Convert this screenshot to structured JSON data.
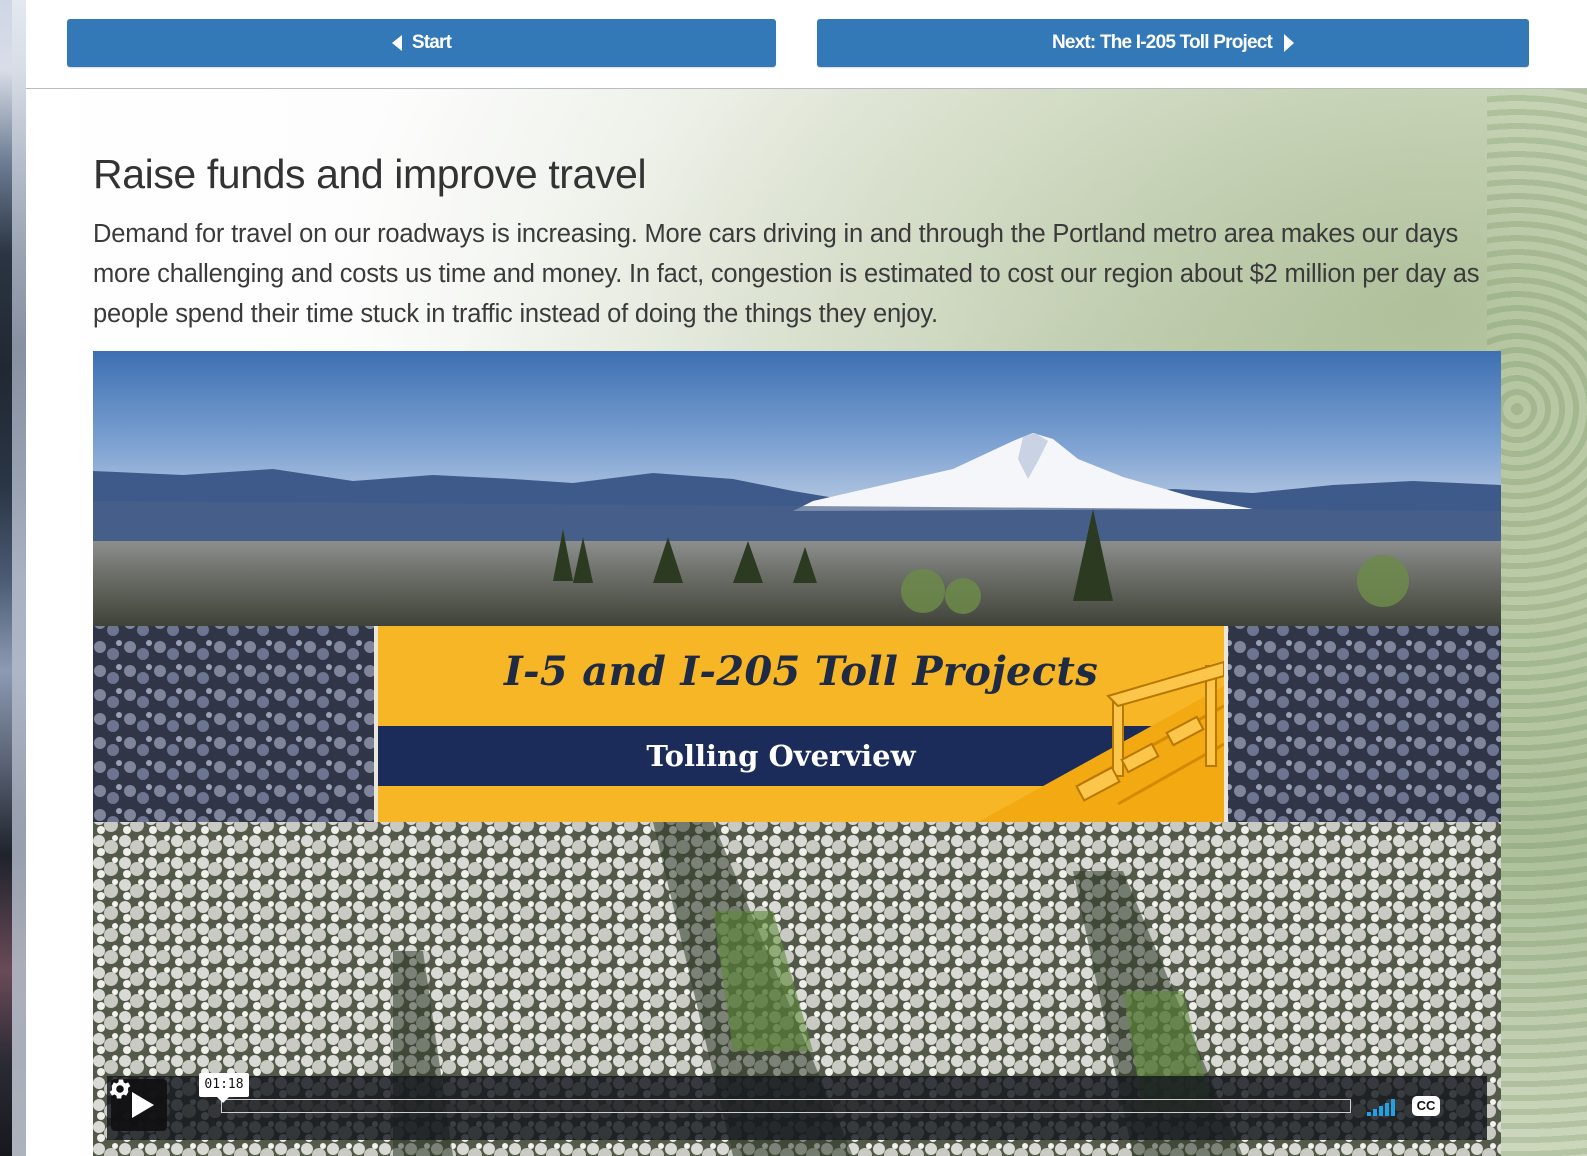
{
  "nav": {
    "start_label": "Start",
    "next_label": "Next: The I-205 Toll Project",
    "accent_color": "#3379b8"
  },
  "section": {
    "title": "Raise funds and improve travel",
    "body": "Demand for travel on our roadways is increasing. More cars driving in and through the Portland metro area makes our days more challenging and costs us time and money. In fact, congestion is estimated to cost our region about $2 million per day as people spend their time stuck in traffic instead of doing the things they enjoy."
  },
  "video": {
    "card_title": "I-5 and I-205 Toll Projects",
    "card_subtitle": "Tolling Overview",
    "card_color": "#f7b626",
    "band_color": "#1b2c5a",
    "hover_time": "01:18",
    "progress_fraction": 0.0,
    "cc_label": "CC",
    "icons": {
      "play": "play-icon",
      "volume": "volume-icon",
      "captions": "closed-captions-icon",
      "settings": "gear-icon",
      "start_arrow": "caret-left-icon",
      "next_arrow": "caret-right-icon"
    }
  }
}
